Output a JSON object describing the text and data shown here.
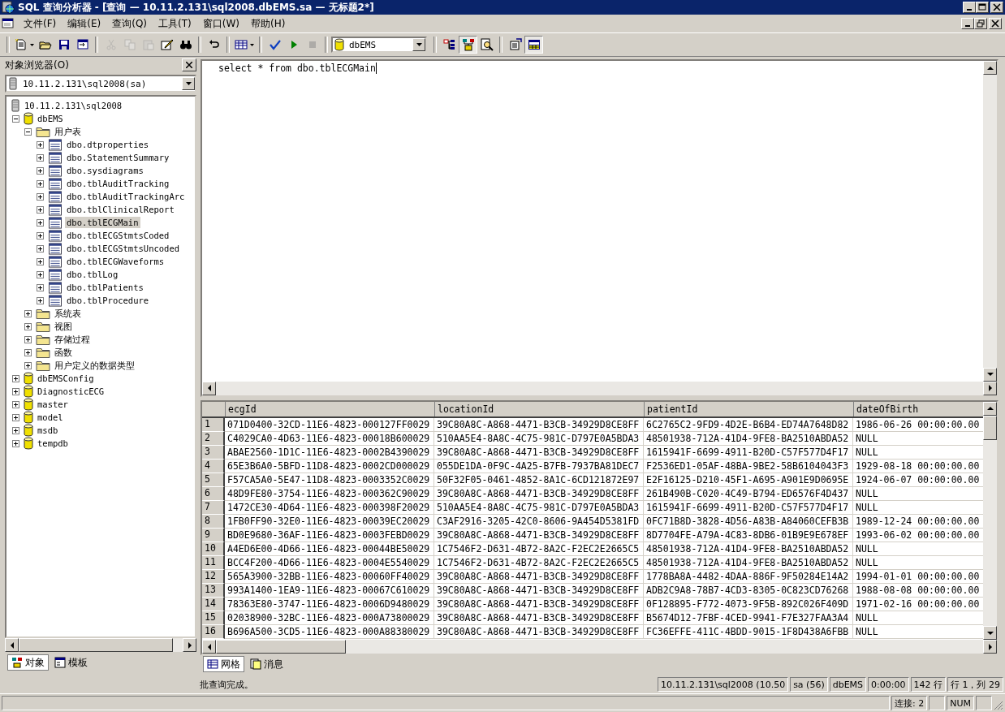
{
  "window": {
    "title": "SQL 查询分析器 - [查询 — 10.11.2.131\\sql2008.dbEMS.sa — 无标题2*]"
  },
  "menu": [
    "文件(F)",
    "编辑(E)",
    "查询(Q)",
    "工具(T)",
    "窗口(W)",
    "帮助(H)"
  ],
  "toolbar": {
    "groups_before": [
      [
        {
          "kind": "new",
          "menu": true,
          "disabled": false,
          "pressed": false
        },
        {
          "kind": "open",
          "menu": false,
          "disabled": false,
          "pressed": false
        },
        {
          "kind": "save",
          "menu": false,
          "disabled": false,
          "pressed": false
        },
        {
          "kind": "insert",
          "menu": false,
          "disabled": false,
          "pressed": false
        }
      ],
      [
        {
          "kind": "cut",
          "menu": false,
          "disabled": true,
          "pressed": false
        },
        {
          "kind": "copy",
          "menu": false,
          "disabled": true,
          "pressed": false
        },
        {
          "kind": "paste",
          "menu": false,
          "disabled": true,
          "pressed": false
        },
        {
          "kind": "edit",
          "menu": false,
          "disabled": false,
          "pressed": false
        },
        {
          "kind": "find",
          "menu": false,
          "disabled": false,
          "pressed": false
        }
      ],
      [
        {
          "kind": "undo",
          "menu": false,
          "disabled": false,
          "pressed": false
        }
      ],
      [
        {
          "kind": "results",
          "menu": true,
          "disabled": false,
          "pressed": false
        }
      ],
      [
        {
          "kind": "check",
          "menu": false,
          "disabled": false,
          "pressed": false
        },
        {
          "kind": "execute",
          "menu": false,
          "disabled": false,
          "pressed": false
        },
        {
          "kind": "stop",
          "menu": false,
          "disabled": true,
          "pressed": false
        }
      ]
    ],
    "database": "dbEMS",
    "groups_after": [
      [
        {
          "kind": "object-browser",
          "menu": false,
          "disabled": false,
          "pressed": false
        },
        {
          "kind": "plan",
          "menu": false,
          "disabled": false,
          "pressed": true
        },
        {
          "kind": "analyze",
          "menu": false,
          "disabled": false,
          "pressed": false
        }
      ],
      [
        {
          "kind": "properties",
          "menu": false,
          "disabled": false,
          "pressed": false
        },
        {
          "kind": "results-pane",
          "menu": false,
          "disabled": false,
          "pressed": true
        }
      ]
    ]
  },
  "object_browser": {
    "title": "对象浏览器(O)",
    "server_select": "10.11.2.131\\sql2008(sa)",
    "tree": [
      {
        "label": "10.11.2.131\\sql2008",
        "kind": "server",
        "selected": false,
        "children": [
          {
            "label": "dbEMS",
            "kind": "database",
            "expanded": true,
            "selected": false,
            "children": [
              {
                "label": "用户表",
                "kind": "folder",
                "expanded": true,
                "selected": false,
                "children": [
                  {
                    "label": "dbo.dtproperties",
                    "kind": "table",
                    "expanded": false,
                    "selected": false
                  },
                  {
                    "label": "dbo.StatementSummary",
                    "kind": "table",
                    "expanded": false,
                    "selected": false
                  },
                  {
                    "label": "dbo.sysdiagrams",
                    "kind": "table",
                    "expanded": false,
                    "selected": false
                  },
                  {
                    "label": "dbo.tblAuditTracking",
                    "kind": "table",
                    "expanded": false,
                    "selected": false
                  },
                  {
                    "label": "dbo.tblAuditTrackingArc",
                    "kind": "table",
                    "expanded": false,
                    "selected": false
                  },
                  {
                    "label": "dbo.tblClinicalReport",
                    "kind": "table",
                    "expanded": false,
                    "selected": false
                  },
                  {
                    "label": "dbo.tblECGMain",
                    "kind": "table",
                    "expanded": false,
                    "selected": true
                  },
                  {
                    "label": "dbo.tblECGStmtsCoded",
                    "kind": "table",
                    "expanded": false,
                    "selected": false
                  },
                  {
                    "label": "dbo.tblECGStmtsUncoded",
                    "kind": "table",
                    "expanded": false,
                    "selected": false
                  },
                  {
                    "label": "dbo.tblECGWaveforms",
                    "kind": "table",
                    "expanded": false,
                    "selected": false
                  },
                  {
                    "label": "dbo.tblLog",
                    "kind": "table",
                    "expanded": false,
                    "selected": false
                  },
                  {
                    "label": "dbo.tblPatients",
                    "kind": "table",
                    "expanded": false,
                    "selected": false
                  },
                  {
                    "label": "dbo.tblProcedure",
                    "kind": "table",
                    "expanded": false,
                    "selected": false
                  }
                ]
              },
              {
                "label": "系统表",
                "kind": "folder",
                "expanded": false,
                "selected": false
              },
              {
                "label": "视图",
                "kind": "folder",
                "expanded": false,
                "selected": false
              },
              {
                "label": "存储过程",
                "kind": "folder",
                "expanded": false,
                "selected": false
              },
              {
                "label": "函数",
                "kind": "folder",
                "expanded": false,
                "selected": false
              },
              {
                "label": "用户定义的数据类型",
                "kind": "folder",
                "expanded": false,
                "selected": false
              }
            ]
          },
          {
            "label": "dbEMSConfig",
            "kind": "database",
            "expanded": false,
            "selected": false
          },
          {
            "label": "DiagnosticECG",
            "kind": "database",
            "expanded": false,
            "selected": false
          },
          {
            "label": "master",
            "kind": "database",
            "expanded": false,
            "selected": false
          },
          {
            "label": "model",
            "kind": "database",
            "expanded": false,
            "selected": false
          },
          {
            "label": "msdb",
            "kind": "database",
            "expanded": false,
            "selected": false
          },
          {
            "label": "tempdb",
            "kind": "database",
            "expanded": false,
            "selected": false
          }
        ]
      }
    ],
    "tabs": [
      {
        "label": "对象",
        "selected": true
      },
      {
        "label": "模板",
        "selected": false
      }
    ]
  },
  "editor": {
    "text": "select * from dbo.tblECGMain"
  },
  "results": {
    "columns": [
      "ecgId",
      "locationId",
      "patientId",
      "dateOfBirth"
    ],
    "rows": [
      {
        "number": "1",
        "cells": [
          "071D0400-32CD-11E6-4823-000127FF0029",
          "39C80A8C-A868-4471-B3CB-34929D8CE8FF",
          "6C2765C2-9FD9-4D2E-B6B4-ED74A7648D82",
          "1986-06-26 00:00:00.00"
        ]
      },
      {
        "number": "2",
        "cells": [
          "C4029CA0-4D63-11E6-4823-00018B600029",
          "510AA5E4-8A8C-4C75-981C-D797E0A5BDA3",
          "48501938-712A-41D4-9FE8-BA2510ABDA52",
          "NULL"
        ]
      },
      {
        "number": "3",
        "cells": [
          "ABAE2560-1D1C-11E6-4823-0002B4390029",
          "39C80A8C-A868-4471-B3CB-34929D8CE8FF",
          "1615941F-6699-4911-B20D-C57F577D4F17",
          "NULL"
        ]
      },
      {
        "number": "4",
        "cells": [
          "65E3B6A0-5BFD-11D8-4823-0002CD000029",
          "055DE1DA-0F9C-4A25-B7FB-7937BA81DEC7",
          "F2536ED1-05AF-48BA-9BE2-58B6104043F3",
          "1929-08-18 00:00:00.00"
        ]
      },
      {
        "number": "5",
        "cells": [
          "F57CA5A0-5E47-11D8-4823-0003352C0029",
          "50F32F05-0461-4852-8A1C-6CD121872E97",
          "E2F16125-D210-45F1-A695-A901E9D0695E",
          "1924-06-07 00:00:00.00"
        ]
      },
      {
        "number": "6",
        "cells": [
          "48D9FE80-3754-11E6-4823-000362C90029",
          "39C80A8C-A868-4471-B3CB-34929D8CE8FF",
          "261B490B-C020-4C49-B794-ED6576F4D437",
          "NULL"
        ]
      },
      {
        "number": "7",
        "cells": [
          "1472CE30-4D64-11E6-4823-000398F20029",
          "510AA5E4-8A8C-4C75-981C-D797E0A5BDA3",
          "1615941F-6699-4911-B20D-C57F577D4F17",
          "NULL"
        ]
      },
      {
        "number": "8",
        "cells": [
          "1FB0FF90-32E0-11E6-4823-00039EC20029",
          "C3AF2916-3205-42C0-8606-9A454D5381FD",
          "0FC71B8D-3828-4D56-A83B-A84060CEFB3B",
          "1989-12-24 00:00:00.00"
        ]
      },
      {
        "number": "9",
        "cells": [
          "BD0E9680-36AF-11E6-4823-0003FEBD0029",
          "39C80A8C-A868-4471-B3CB-34929D8CE8FF",
          "8D7704FE-A79A-4C83-8DB6-01B9E9E678EF",
          "1993-06-02 00:00:00.00"
        ]
      },
      {
        "number": "10",
        "cells": [
          "A4ED6E00-4D66-11E6-4823-00044BE50029",
          "1C7546F2-D631-4B72-8A2C-F2EC2E2665C5",
          "48501938-712A-41D4-9FE8-BA2510ABDA52",
          "NULL"
        ]
      },
      {
        "number": "11",
        "cells": [
          "BCC4F200-4D66-11E6-4823-0004E5540029",
          "1C7546F2-D631-4B72-8A2C-F2EC2E2665C5",
          "48501938-712A-41D4-9FE8-BA2510ABDA52",
          "NULL"
        ]
      },
      {
        "number": "12",
        "cells": [
          "565A3900-32BB-11E6-4823-00060FF40029",
          "39C80A8C-A868-4471-B3CB-34929D8CE8FF",
          "1778BA8A-4482-4DAA-886F-9F50284E14A2",
          "1994-01-01 00:00:00.00"
        ]
      },
      {
        "number": "13",
        "cells": [
          "993A1400-1EA9-11E6-4823-00067C610029",
          "39C80A8C-A868-4471-B3CB-34929D8CE8FF",
          "ADB2C9A8-78B7-4CD3-8305-0C823CD76268",
          "1988-08-08 00:00:00.00"
        ]
      },
      {
        "number": "14",
        "cells": [
          "78363E80-3747-11E6-4823-0006D9480029",
          "39C80A8C-A868-4471-B3CB-34929D8CE8FF",
          "0F128895-F772-4073-9F5B-892C026F409D",
          "1971-02-16 00:00:00.00"
        ]
      },
      {
        "number": "15",
        "cells": [
          "02038900-32BC-11E6-4823-000A73800029",
          "39C80A8C-A868-4471-B3CB-34929D8CE8FF",
          "B5674D12-7FBF-4CED-9941-F7E327FAA3A4",
          "NULL"
        ]
      },
      {
        "number": "16",
        "cells": [
          "B696A500-3CD5-11E6-4823-000A88380029",
          "39C80A8C-A868-4471-B3CB-34929D8CE8FF",
          "FC36EFFE-411C-4BDD-9015-1F8D438A6FBB",
          "NULL"
        ]
      }
    ],
    "tabs": [
      {
        "label": "网格",
        "selected": true
      },
      {
        "label": "消息",
        "selected": false
      }
    ]
  },
  "status_bar": [
    "批查询完成。",
    "10.11.2.131\\sql2008 (10.50",
    "sa (56)",
    "dbEMS",
    "0:00:00",
    "142 行",
    "行 1，列 29"
  ],
  "app_status": [
    "连接: 2",
    "NUM"
  ]
}
